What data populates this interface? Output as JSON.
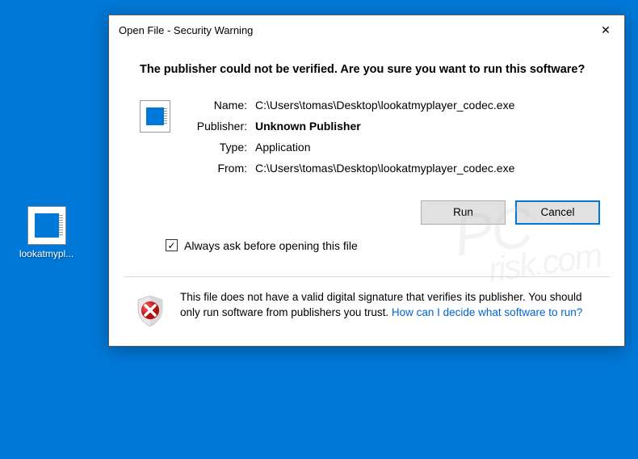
{
  "desktop": {
    "icon_label": "lookatmypl..."
  },
  "dialog": {
    "title": "Open File - Security Warning",
    "question": "The publisher could not be verified.  Are you sure you want to run this software?",
    "labels": {
      "name": "Name:",
      "publisher": "Publisher:",
      "type": "Type:",
      "from": "From:"
    },
    "values": {
      "name": "C:\\Users\\tomas\\Desktop\\lookatmyplayer_codec.exe",
      "publisher": "Unknown Publisher",
      "type": "Application",
      "from": "C:\\Users\\tomas\\Desktop\\lookatmyplayer_codec.exe"
    },
    "buttons": {
      "run": "Run",
      "cancel": "Cancel"
    },
    "checkbox_label": "Always ask before opening this file",
    "checkbox_checked": true,
    "footer_text": "This file does not have a valid digital signature that verifies its publisher.  You should only run software from publishers you trust.   ",
    "footer_link": "How can I decide what software to run?"
  },
  "watermark": {
    "line1": "PC",
    "line2": "risk.com"
  }
}
